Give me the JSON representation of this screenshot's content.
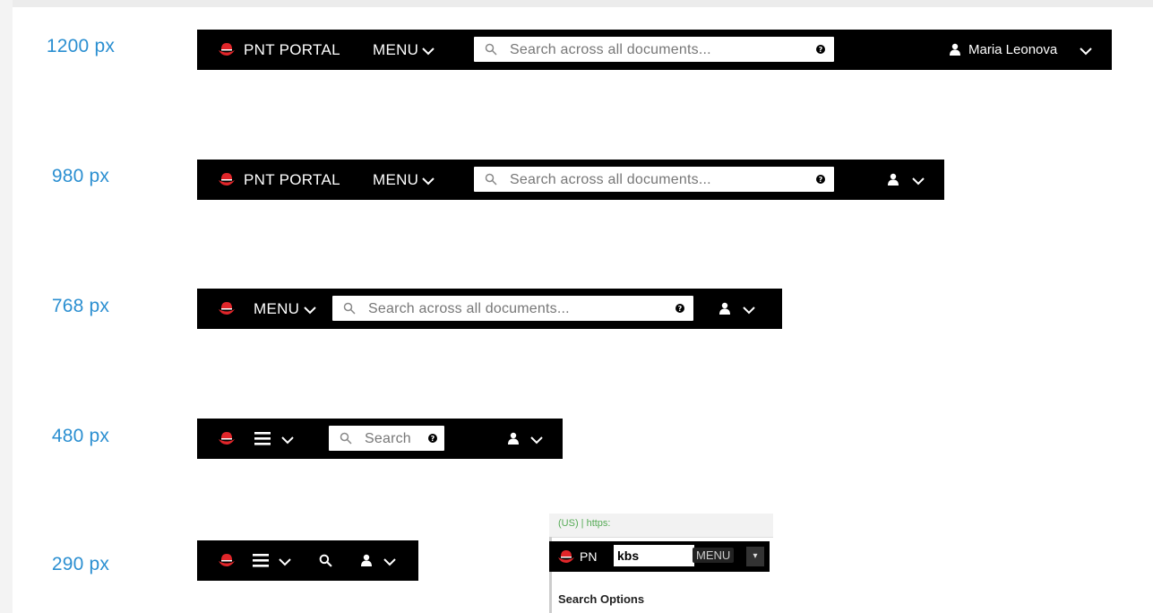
{
  "breakpoints": [
    {
      "label": "1200 px"
    },
    {
      "label": "980 px"
    },
    {
      "label": "768 px"
    },
    {
      "label": "480 px"
    },
    {
      "label": "290 px"
    }
  ],
  "header": {
    "brand": "PNT PORTAL",
    "menu_label": "MENU",
    "search_placeholder_long": "Search across all documents...",
    "search_placeholder_short": "Search",
    "user_name": "Maria Leonova"
  },
  "colors": {
    "bar_background": "#000000",
    "label_blue": "#2b8fd1",
    "logo_red": "#e0262a"
  },
  "icons": [
    "redhat-logo-icon",
    "chevron-down-icon",
    "search-icon",
    "help-icon",
    "user-icon",
    "hamburger-icon"
  ],
  "inset": {
    "address_text": "(US) | https:",
    "brand_partial": "PN",
    "field_text": "kbs",
    "menu_label": "MENU",
    "search_options": "Search Options"
  }
}
